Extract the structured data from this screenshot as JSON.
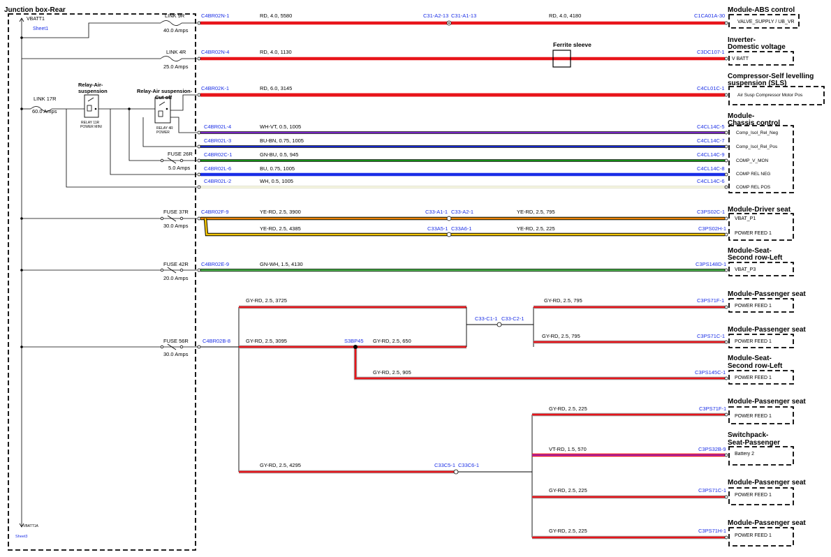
{
  "junction_box": {
    "title": "Junction box-Rear",
    "vbatt_top": "VBATT1",
    "sheet_top": "Sheet1",
    "vbatt_bottom": "VBATT1A",
    "sheet_bottom": "Sheet3",
    "link17": {
      "name": "LINK 17R",
      "amps": "60.0 Amps"
    },
    "relay1": {
      "title": "Relay-Air-suspension",
      "sub1": "RELAY 11R",
      "sub2": "POWER MINI"
    },
    "relay2": {
      "title": "Relay-Air suspension-Cut off",
      "sub1": "RELAY 4R",
      "sub2": "POWER"
    },
    "fuses": [
      {
        "name": "LINK 9R",
        "amps": "40.0 Amps"
      },
      {
        "name": "LINK 4R",
        "amps": "25.0 Amps"
      },
      {
        "name": "FUSE 26R",
        "amps": "5.0 Amps"
      },
      {
        "name": "FUSE 37R",
        "amps": "30.0 Amps"
      },
      {
        "name": "FUSE 42R",
        "amps": "20.0 Amps"
      },
      {
        "name": "FUSE 56R",
        "amps": "30.0 Amps"
      }
    ]
  },
  "wires": [
    {
      "from": "C4BR02N-1",
      "spec1": "RD, 4.0, 5580",
      "mid1": "C31-A2-13",
      "mid2": "C31-A1-13",
      "spec2": "RD, 4.0, 4180",
      "to": "C1CA01A-30",
      "color": "#e8141a"
    },
    {
      "from": "C4BR02N-4",
      "spec1": "RD, 4.0, 1130",
      "to": "C3DC107-1",
      "ferrite": "Ferrite sleeve",
      "color": "#e8141a"
    },
    {
      "from": "C4BR02K-1",
      "spec1": "RD, 6.0, 3145",
      "to": "C4CL01C-1",
      "color": "#e8141a"
    },
    {
      "from": "C4BR02L-4",
      "spec1": "WH-VT, 0.5, 1005",
      "to": "C4CL14C-5",
      "color": "#8a2be2"
    },
    {
      "from": "C4BR02L-3",
      "spec1": "BU-BN, 0.75, 1005",
      "to": "C4CL14C-7",
      "color": "#1a2ee6"
    },
    {
      "from": "C4BR02C-1",
      "spec1": "GN-BU, 0.5, 945",
      "to": "C4CL14C-9",
      "color": "#1aa31a"
    },
    {
      "from": "C4BR02L-6",
      "spec1": "BU, 0.75, 1005",
      "to": "C4CL14C-8",
      "color": "#1a2ee6"
    },
    {
      "from": "C4BR02L-2",
      "spec1": "WH, 0.5, 1005",
      "to": "C4CL14C-6",
      "color": "#f4f4d8"
    },
    {
      "from": "C4BR02F-9",
      "spec1": "YE-RD, 2.5, 3900",
      "mid1": "C33-A1-1",
      "mid2": "C33-A2-1",
      "spec2": "YE-RD, 2.5, 795",
      "to": "C3PS02C-1",
      "color": "#f2c400"
    },
    {
      "spec1": "YE-RD, 2.5, 4385",
      "mid1": "C33A5-1",
      "mid2": "C33A6-1",
      "spec2": "YE-RD, 2.5, 225",
      "to": "C3PS02H-1",
      "color": "#f2c400"
    },
    {
      "from": "C4BR02E-9",
      "spec1": "GN-WH, 1.5, 4130",
      "to": "C3PS148D-1",
      "color": "#1aa31a"
    },
    {
      "from": "C4BR02B-8",
      "spec1": "GY-RD, 2.5, 3725",
      "spec2": "GY-RD, 2.5, 795",
      "to": "C3PS71F-1",
      "color": "#e8141a"
    },
    {
      "spec1": "GY-RD, 2.5, 3095",
      "splice": "S3BP45",
      "spec2": "GY-RD, 2.5, 650",
      "mid1": "C33-C1-1",
      "mid2": "C33-C2-1",
      "spec3": "GY-RD, 2.5, 795",
      "to": "C3PS71C-1",
      "color": "#e8141a"
    },
    {
      "spec1": "GY-RD, 2.5, 905",
      "to": "C3PS145C-1",
      "color": "#e8141a"
    },
    {
      "spec1": "GY-RD, 2.5, 4295",
      "mid1": "C33C5-1",
      "mid2": "C33C6-1",
      "color": "#e8141a"
    },
    {
      "spec1": "GY-RD, 2.5, 225",
      "to": "C3PS71F-1",
      "color": "#e8141a"
    },
    {
      "spec1": "VT-RD, 1.5, 570",
      "to": "C3PS32B-9",
      "color": "#8a2be2"
    },
    {
      "spec1": "GY-RD, 2.5, 225",
      "to": "C3PS71C-1",
      "color": "#e8141a"
    },
    {
      "spec1": "GY-RD, 2.5, 225",
      "to": "C3PS71H-1",
      "color": "#e8141a"
    }
  ],
  "modules": [
    {
      "title1": "Module-ABS control",
      "title2": "",
      "pins": [
        "VALVE_SUPPLY / UB_VR"
      ]
    },
    {
      "title1": "Inverter-",
      "title2": "Domestic voltage",
      "pins": [
        "V BATT"
      ]
    },
    {
      "title1": "Compressor-Self levelling",
      "title2": "suspension (SLS)",
      "pins": [
        "Air Susp Compressor Motor Pos"
      ]
    },
    {
      "title1": "Module-",
      "title2": "Chassis control",
      "pins": [
        "Comp_Isol_Rel_Neg",
        "Comp_Isol_Rel_Pos",
        "COMP_V_MON",
        "COMP REL NEG",
        "COMP REL POS"
      ]
    },
    {
      "title1": "Module-Driver seat",
      "title2": "",
      "pins": [
        "VBAT_P1",
        "POWER FEED 1"
      ]
    },
    {
      "title1": "Module-Seat-",
      "title2": "Second row-Left",
      "pins": [
        "VBAT_P3"
      ]
    },
    {
      "title1": "Module-Passenger seat",
      "title2": "",
      "pins": [
        "POWER FEED 1"
      ]
    },
    {
      "title1": "Module-Passenger seat",
      "title2": "",
      "pins": [
        "POWER FEED 1"
      ]
    },
    {
      "title1": "Module-Seat-",
      "title2": "Second row-Left",
      "pins": [
        "POWER FEED 1"
      ]
    },
    {
      "title1": "Module-Passenger seat",
      "title2": "",
      "pins": [
        "POWER FEED 1"
      ]
    },
    {
      "title1": "Switchpack-",
      "title2": "Seat-Passenger",
      "pins": [
        "Battery 2"
      ]
    },
    {
      "title1": "Module-Passenger seat",
      "title2": "",
      "pins": [
        "POWER FEED 1"
      ]
    },
    {
      "title1": "Module-Passenger seat",
      "title2": "",
      "pins": [
        "POWER FEED 1"
      ]
    }
  ]
}
